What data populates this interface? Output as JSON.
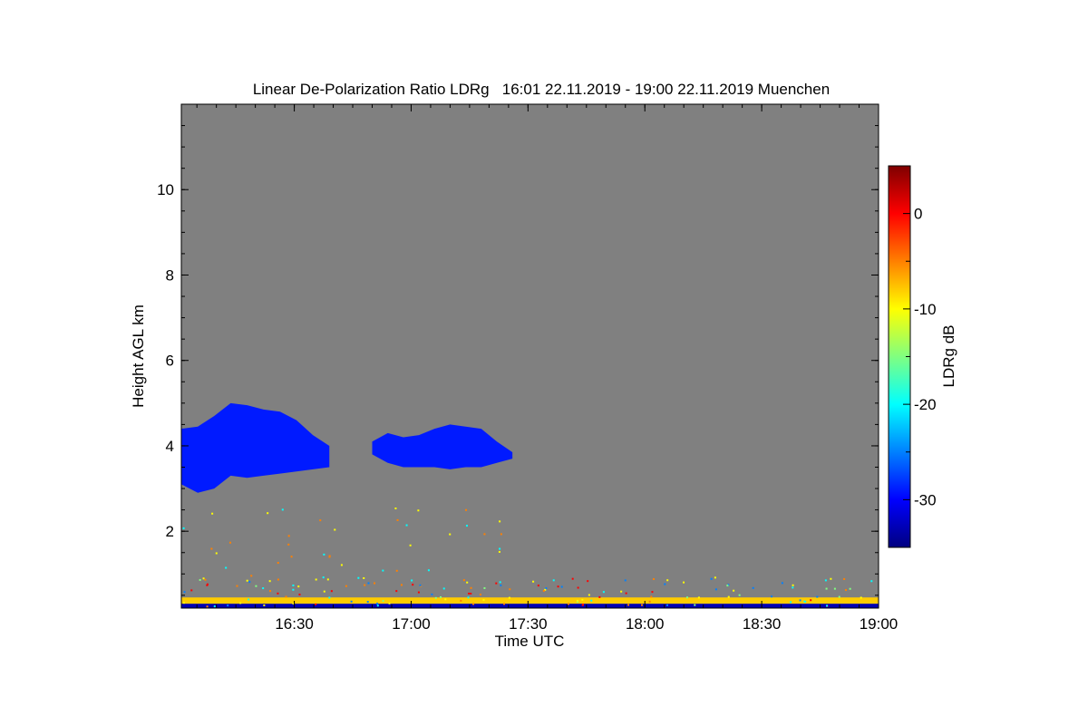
{
  "chart_data": {
    "type": "heatmap",
    "title": "Linear De-Polarization Ratio LDRg   16:01 22.11.2019 - 19:00 22.11.2019 Muenchen",
    "xlabel": "Time UTC",
    "ylabel": "Height AGL km",
    "x_range_minutes_utc": [
      961,
      1140
    ],
    "y_range_km": [
      0.2,
      12.0
    ],
    "x_ticks": [
      {
        "value": 990,
        "label": "16:30"
      },
      {
        "value": 1020,
        "label": "17:00"
      },
      {
        "value": 1050,
        "label": "17:30"
      },
      {
        "value": 1080,
        "label": "18:00"
      },
      {
        "value": 1110,
        "label": "18:30"
      },
      {
        "value": 1140,
        "label": "19:00"
      }
    ],
    "y_ticks": [
      {
        "value": 2,
        "label": "2"
      },
      {
        "value": 4,
        "label": "4"
      },
      {
        "value": 6,
        "label": "6"
      },
      {
        "value": 8,
        "label": "8"
      },
      {
        "value": 10,
        "label": "10"
      }
    ],
    "background_color": "#808080",
    "colorbar": {
      "label": "LDRg dB",
      "range": [
        -35,
        5
      ],
      "ticks": [
        {
          "value": 0,
          "label": "0"
        },
        {
          "value": -10,
          "label": "-10"
        },
        {
          "value": -20,
          "label": "-20"
        },
        {
          "value": -30,
          "label": "-30"
        }
      ],
      "colormap": [
        "#00007f",
        "#0000ff",
        "#0080ff",
        "#00ffff",
        "#80ff80",
        "#ffff00",
        "#ff8000",
        "#ff0000",
        "#7f0000"
      ]
    },
    "regions": [
      {
        "name": "cloud-left",
        "ldr_db": -29,
        "x_start": 961,
        "x_end": 999,
        "base_km": [
          3.1,
          2.9,
          3.0,
          3.3,
          3.25,
          3.3,
          3.35,
          3.4,
          3.45,
          3.5
        ],
        "top_km": [
          4.4,
          4.45,
          4.7,
          5.0,
          4.95,
          4.85,
          4.8,
          4.6,
          4.25,
          4.0
        ]
      },
      {
        "name": "cloud-middle",
        "ldr_db": -29,
        "x_start": 1010,
        "x_end": 1046,
        "base_km": [
          3.8,
          3.6,
          3.5,
          3.5,
          3.5,
          3.45,
          3.5,
          3.5,
          3.6,
          3.7
        ],
        "top_km": [
          4.1,
          4.3,
          4.2,
          4.25,
          4.4,
          4.5,
          4.45,
          4.4,
          4.1,
          3.85
        ]
      },
      {
        "name": "ground-clutter-band",
        "ldr_db": -8,
        "x_start": 961,
        "x_end": 1140,
        "base_km": [
          0.3
        ],
        "top_km": [
          0.45
        ]
      },
      {
        "name": "surface-low-ldr",
        "ldr_db": -33,
        "x_start": 961,
        "x_end": 1140,
        "base_km": [
          0.2
        ],
        "top_km": [
          0.3
        ]
      }
    ]
  }
}
